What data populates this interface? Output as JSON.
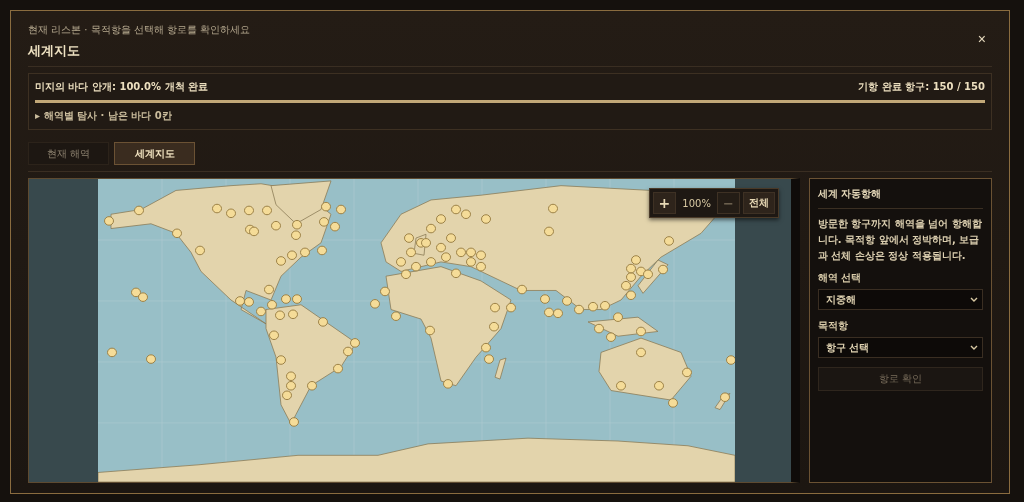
{
  "header": {
    "subtitle": "현재 리스본 · 목적항을 선택해 항로를 확인하세요",
    "title": "세계지도",
    "close": "×"
  },
  "progress": {
    "label": "미지의 바다 안개: 100.0% 개척 완료",
    "ports": "기항 완료 항구: 150 / 150",
    "level": 1.0,
    "details": "▸ 해역별 탐사 · 남은 바다 0칸"
  },
  "tabs": [
    {
      "label": "현재 해역",
      "selected": false
    },
    {
      "label": "세계지도",
      "selected": true
    }
  ],
  "zoom": {
    "zoom_in": "+",
    "percent": "100%",
    "zoom_out": "−",
    "fit": "전체"
  },
  "panel": {
    "title": "세계 자동항해",
    "description": "방문한 항구까지 해역을 넘어 항해합니다. 목적항 앞에서 정박하며, 보급과 선체 손상은 정상 적용됩니다.",
    "region_label": "해역 선택",
    "region_value": "지중해",
    "destination_label": "목적항",
    "destination_value": "항구 선택",
    "confirm": {
      "label": "항로 확인",
      "disabled": true
    }
  }
}
